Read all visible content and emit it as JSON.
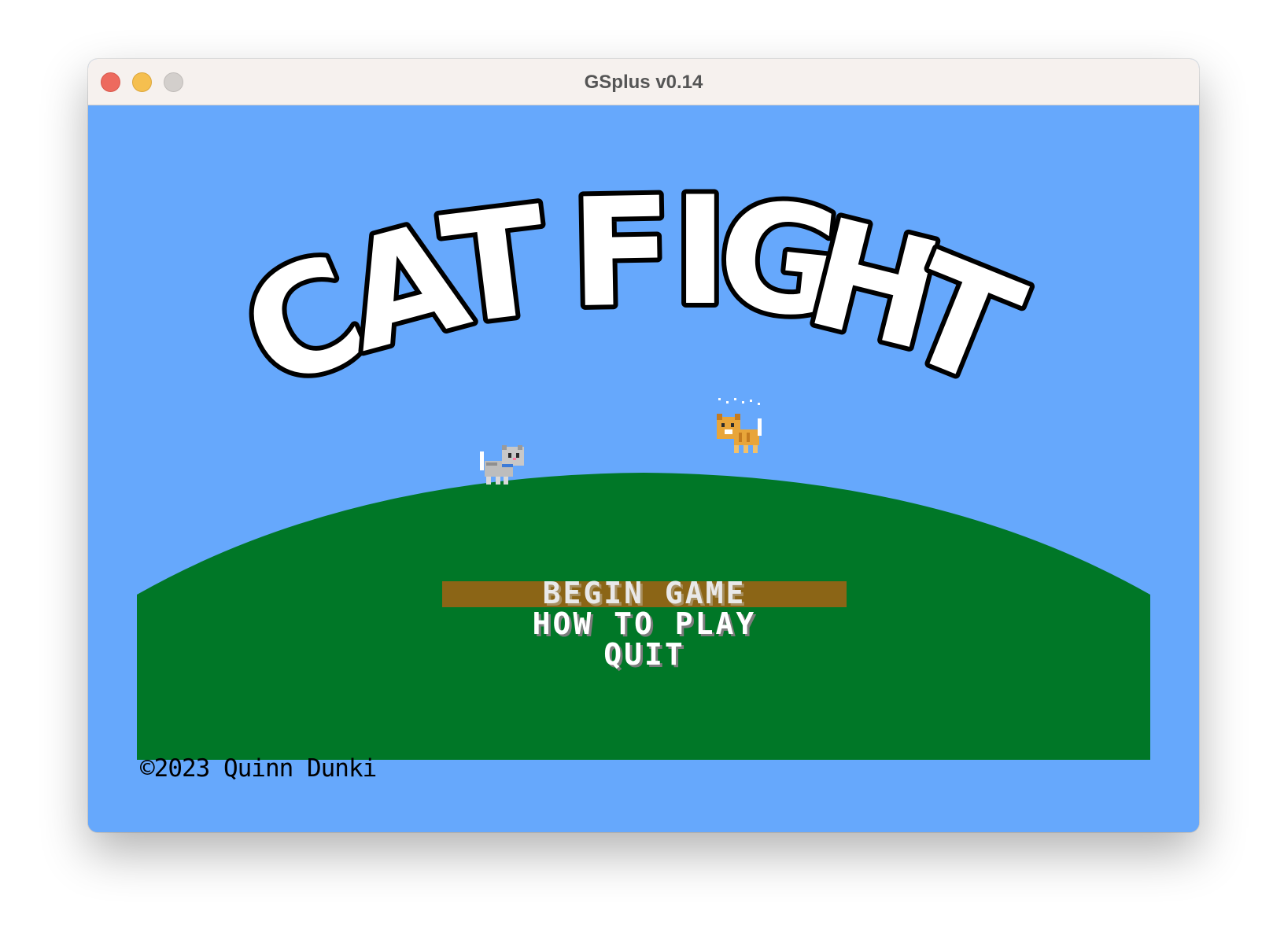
{
  "window": {
    "title": "GSplus v0.14"
  },
  "game": {
    "title": "CAT FIGHT",
    "menu": {
      "items": [
        {
          "label": "BEGIN GAME",
          "selected": true
        },
        {
          "label": "HOW TO PLAY",
          "selected": false
        },
        {
          "label": "QUIT",
          "selected": false
        }
      ]
    },
    "copyright": "©2023 Quinn Dunki"
  },
  "colors": {
    "sky": "#66a8fc",
    "grass": "#007727",
    "menu_highlight": "#8b6516",
    "title_fill": "#ffffff",
    "title_outline": "#000000"
  },
  "icons": [
    "grey-cat-sprite",
    "orange-cat-sprite",
    "close-icon",
    "minimize-icon",
    "maximize-icon"
  ]
}
